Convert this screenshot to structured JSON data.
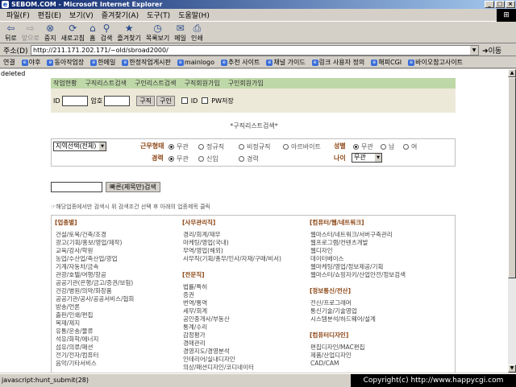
{
  "window": {
    "title": "SEBOM.COM - Microsoft Internet Explorer"
  },
  "menu": [
    "파일(F)",
    "편집(E)",
    "보기(V)",
    "즐겨찾기(A)",
    "도구(T)",
    "도움말(H)"
  ],
  "toolbar": [
    {
      "label": "뒤로",
      "icon": "back-arrow-icon",
      "glyph": "⇦",
      "enabled": true
    },
    {
      "label": "앞으로",
      "icon": "forward-arrow-icon",
      "glyph": "⇨",
      "enabled": false
    },
    {
      "label": "중지",
      "icon": "stop-icon",
      "glyph": "⊗",
      "enabled": true
    },
    {
      "label": "새로고침",
      "icon": "refresh-icon",
      "glyph": "⟳",
      "enabled": true
    },
    {
      "label": "홈",
      "icon": "home-icon",
      "glyph": "⌂",
      "enabled": true
    },
    {
      "label": "검색",
      "icon": "search-icon",
      "glyph": "⚲",
      "enabled": true
    },
    {
      "label": "즐겨찾기",
      "icon": "favorites-icon",
      "glyph": "★",
      "enabled": true
    },
    {
      "label": "목록보기",
      "icon": "history-icon",
      "glyph": "◷",
      "enabled": true
    },
    {
      "label": "메일",
      "icon": "mail-icon",
      "glyph": "✉",
      "enabled": true
    },
    {
      "label": "인쇄",
      "icon": "print-icon",
      "glyph": "⎙",
      "enabled": true
    }
  ],
  "address": {
    "label": "주소(D)",
    "url": "http://211.171.202.171/~old/sbroad2000/",
    "go": "이동"
  },
  "links": {
    "label": "연결",
    "items": [
      "야후",
      "동아작업장",
      "한메일",
      "한정작업게시판",
      "mainlogo",
      "추천 사이트",
      "채널 가이드",
      "링크 사용자 정의",
      "해피CGI",
      "바이오참고사이트"
    ]
  },
  "page": {
    "deleted": "deleted",
    "topnav": [
      "작업현황",
      "구직리스트검색",
      "구인리스트검색",
      "구직회원가입",
      "구인회원가입"
    ],
    "login": {
      "id_label": "ID",
      "pw_label": "암호",
      "btn_seek": "구직",
      "btn_hire": "구인",
      "chk_id": "ID",
      "chk_pw": "PW저장"
    },
    "heading": "*구직리스트검색*",
    "filter": {
      "region": "지역선택(전체)",
      "work_type_label": "근무형태",
      "work_types": [
        "무관",
        "정규직",
        "비정규직",
        "아르바이트"
      ],
      "gender_label": "성별",
      "genders": [
        "무관",
        "남",
        "여"
      ],
      "career_label": "경력",
      "careers": [
        "무관",
        "신입",
        "경력"
      ],
      "age_label": "나이",
      "age": "무관"
    },
    "search_button": "빠른(제목만)검색",
    "notice": "☞해당업종에서만 검색시 위 검색조건 선택 후 아래의 업종제목 클릭",
    "categories": [
      {
        "title": "[업종별]",
        "items": [
          "건설/토목/건축/조경",
          "광고(기획/홍보/영업/제작)",
          "교육/강사/학원",
          "농업/수산업/축산업/광업",
          "기계/자동차/금속",
          "관광/호텔/여행/항공",
          "공공기관(은행/금고/증권/보험)",
          "건강/병원/의약/화장품",
          "공공기관/공사/공공서비스/협회",
          "방송/언론",
          "출판/인쇄/편집",
          "목재/제지",
          "유통/운송/물류",
          "석유/화학/에너지",
          "섬유/의류/패션",
          "전기/전자/컴퓨터",
          "음악/기타서비스"
        ]
      },
      {
        "title": "[사무관리직]",
        "items": [
          "경리/회계/재무",
          "마케팅/영업(국내)",
          "무역/영업(해외)",
          "사무직(기획/총무/인사/자재/구매/비서)"
        ],
        "title2": "[전문직]",
        "items2": [
          "법률/특허",
          "증권",
          "번역/통역",
          "세무/회계",
          "공인중개사/부동산",
          "통계/수리",
          "감정평가",
          "경매관리",
          "경영지도/경영분석",
          "인테리어/실내디자인",
          "의상/패션디자인/코디네이터"
        ]
      },
      {
        "title": "[컴퓨터/웹/네트워크]",
        "items": [
          "웹마스터/네트워크/서버구축관리",
          "웹프로그램/컨텐츠개발",
          "웹디자인",
          "데이터베이스",
          "웹마케팅/영업/정보제공/기획",
          "웹마스터/쇼핑자키/산업안전/정보검색"
        ],
        "title2": "[정보통신/전산]",
        "items2": [
          "전산/프로그래머",
          "통신기술/기술영업",
          "시스템분석/하드웨어/설계"
        ],
        "title3": "[컴퓨터디자인]",
        "items3": [
          "편집디자인/MAC편집",
          "제품/산업디자인",
          "CAD/CAM"
        ]
      }
    ]
  },
  "status": {
    "text": "javascript:hunt_submit(28)",
    "copyright": "Copyright(c) http://www.happycgi.com"
  }
}
